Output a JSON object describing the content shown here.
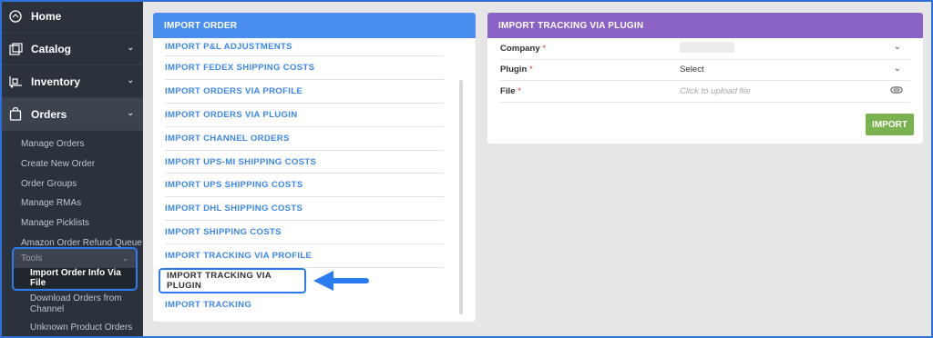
{
  "sidebar": {
    "items": [
      {
        "label": "Home",
        "icon": "home-icon"
      },
      {
        "label": "Catalog",
        "icon": "catalog-icon"
      },
      {
        "label": "Inventory",
        "icon": "inventory-icon"
      },
      {
        "label": "Orders",
        "icon": "bag-icon"
      }
    ],
    "order_subitems": [
      "Manage Orders",
      "Create New Order",
      "Order Groups",
      "Manage RMAs",
      "Manage Picklists",
      "Amazon Order Refund Queue"
    ],
    "tools_label": "Tools",
    "tools_selected": "Import Order Info Via File",
    "tools_after": [
      "Download Orders from Channel",
      "Unknown Product Orders"
    ]
  },
  "import_order": {
    "title": "IMPORT ORDER",
    "items": [
      "IMPORT P&L ADJUSTMENTS",
      "IMPORT FEDEX SHIPPING COSTS",
      "IMPORT ORDERS VIA PROFILE",
      "IMPORT ORDERS VIA PLUGIN",
      "IMPORT CHANNEL ORDERS",
      "IMPORT UPS-MI SHIPPING COSTS",
      "IMPORT UPS SHIPPING COSTS",
      "IMPORT DHL SHIPPING COSTS",
      "IMPORT SHIPPING COSTS",
      "IMPORT TRACKING VIA PROFILE",
      "IMPORT TRACKING VIA PLUGIN",
      "IMPORT TRACKING"
    ],
    "highlighted_index": 10
  },
  "tracking_panel": {
    "title": "IMPORT TRACKING VIA PLUGIN",
    "company_label": "Company",
    "plugin_label": "Plugin",
    "plugin_value": "Select",
    "file_label": "File",
    "file_placeholder": "Click to upload file",
    "required_mark": "*",
    "import_button": "IMPORT"
  },
  "colors": {
    "sidebar_bg": "#2b323b",
    "import_order_header": "#4a8ff0",
    "tracking_header": "#8b63c6",
    "import_button": "#79b24e",
    "highlight_border": "#2a7cf0"
  }
}
